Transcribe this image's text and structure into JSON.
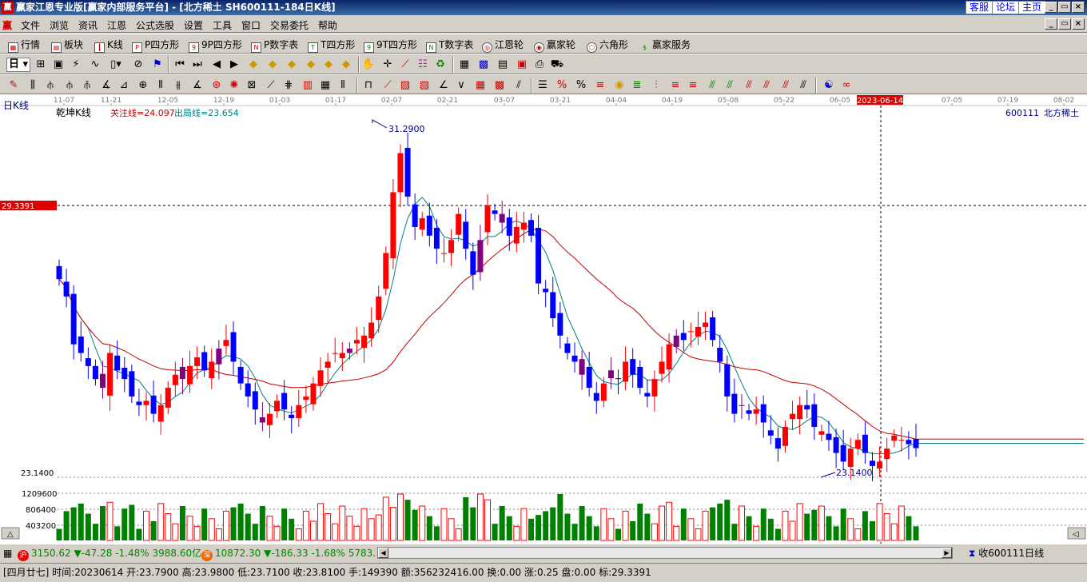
{
  "titlebar": {
    "app_icon": "赢",
    "title": "赢家江恩专业版[赢家内部服务平台] - [北方稀土  SH600111-184日K线]",
    "links": [
      "客服",
      "论坛",
      "主页"
    ]
  },
  "menubar": {
    "logo": "赢",
    "items": [
      "文件",
      "浏览",
      "资讯",
      "江恩",
      "公式选股",
      "设置",
      "工具",
      "窗口",
      "交易委托",
      "帮助"
    ]
  },
  "toolbar1": {
    "items": [
      {
        "icon": "grid-icon",
        "label": "行情"
      },
      {
        "icon": "blocks-icon",
        "label": "板块"
      },
      {
        "icon": "kline-icon",
        "label": "K线"
      },
      {
        "icon": "ps-icon",
        "label": "P四方形"
      },
      {
        "icon": "p9-icon",
        "label": "9P四方形"
      },
      {
        "icon": "pn-icon",
        "label": "P数字表"
      },
      {
        "icon": "ts-icon",
        "label": "T四方形"
      },
      {
        "icon": "t9-icon",
        "label": "9T四方形"
      },
      {
        "icon": "tn-icon",
        "label": "T数字表"
      },
      {
        "icon": "wheel-icon",
        "label": "江恩轮"
      },
      {
        "icon": "winner-wheel-icon",
        "label": "赢家轮"
      },
      {
        "icon": "hexagon-icon",
        "label": "六角形"
      },
      {
        "icon": "dollar-icon",
        "label": "赢家服务"
      }
    ]
  },
  "toolbar2": {
    "period": "日"
  },
  "chart": {
    "period_label": "日K线",
    "chart_name": "乾坤K线",
    "focus_line": "关注线=24.097",
    "exit_line": "出局线=23.654",
    "stock_code": "600111",
    "stock_name": "北方稀土",
    "cursor_price": "29.3391",
    "cursor_date": "2023-06-14",
    "high_label": "31.2900",
    "low_label": "23.1400",
    "axis_low": "23.1400",
    "vol_ticks": [
      "1209600",
      "806400",
      "403200"
    ],
    "date_ticks": [
      "11-07",
      "11-21",
      "12-05",
      "12-19",
      "01-03",
      "01-17",
      "02-07",
      "02-21",
      "03-07",
      "03-21",
      "04-04",
      "04-19",
      "05-08",
      "05-22",
      "06-05",
      "07-05",
      "07-19",
      "08-02"
    ],
    "colors": {
      "up": "#ff0000",
      "down": "#0000ff",
      "mixed": "#800080",
      "volume_up": "#ff0000",
      "volume_down": "#008000",
      "ma_fast": "#008080",
      "ma_slow": "#c00000"
    }
  },
  "chart_data": {
    "type": "candlestick",
    "title": "乾坤K线",
    "ylim": [
      23.14,
      31.29
    ],
    "series": [
      {
        "name": "关注线",
        "value": 24.097
      },
      {
        "name": "出局线",
        "value": 23.654
      }
    ],
    "highlights": {
      "high": 31.29,
      "low": 23.14,
      "cursor": 29.3391
    }
  },
  "statusbar": {
    "sh_badge": "沪",
    "sh_index": "3150.62",
    "sh_change": "▼-47.28",
    "sh_pct": "-1.48%",
    "sh_amount": "3988.60亿",
    "sz_badge": "深",
    "sz_index": "10872.30",
    "sz_change": "▼-186.33",
    "sz_pct": "-1.68%",
    "sz_amount": "5783.",
    "right_label": "收600111日线"
  },
  "infobar": {
    "text": "[四月廿七] 时间:20230614 开:23.7900 高:23.9800 低:23.7100 收:23.8100 手:149390 额:356232416.00 换:0.00 涨:0.25 盘:0.00 标:29.3391"
  }
}
